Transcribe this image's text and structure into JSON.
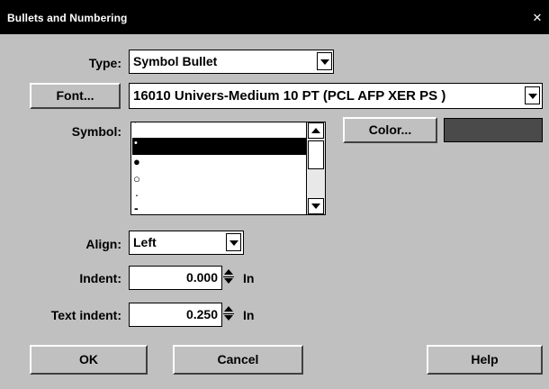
{
  "window": {
    "title": "Bullets and Numbering",
    "close_glyph": "✕"
  },
  "type": {
    "label": "Type:",
    "value": "Symbol Bullet"
  },
  "font": {
    "button_label": "Font...",
    "value": "16010  Univers-Medium 10 PT (PCL AFP XER PS )"
  },
  "symbol": {
    "label": "Symbol:",
    "items": [
      "'",
      "•",
      "●",
      "○",
      ".",
      "-"
    ],
    "selected_index": 1
  },
  "color": {
    "button_label": "Color...",
    "swatch": "#4a4a4a"
  },
  "align": {
    "label": "Align:",
    "value": "Left"
  },
  "indent": {
    "label": "Indent:",
    "value": "0.000",
    "unit": "In"
  },
  "text_indent": {
    "label": "Text indent:",
    "value": "0.250",
    "unit": "In"
  },
  "buttons": {
    "ok": "OK",
    "cancel": "Cancel",
    "help": "Help"
  }
}
